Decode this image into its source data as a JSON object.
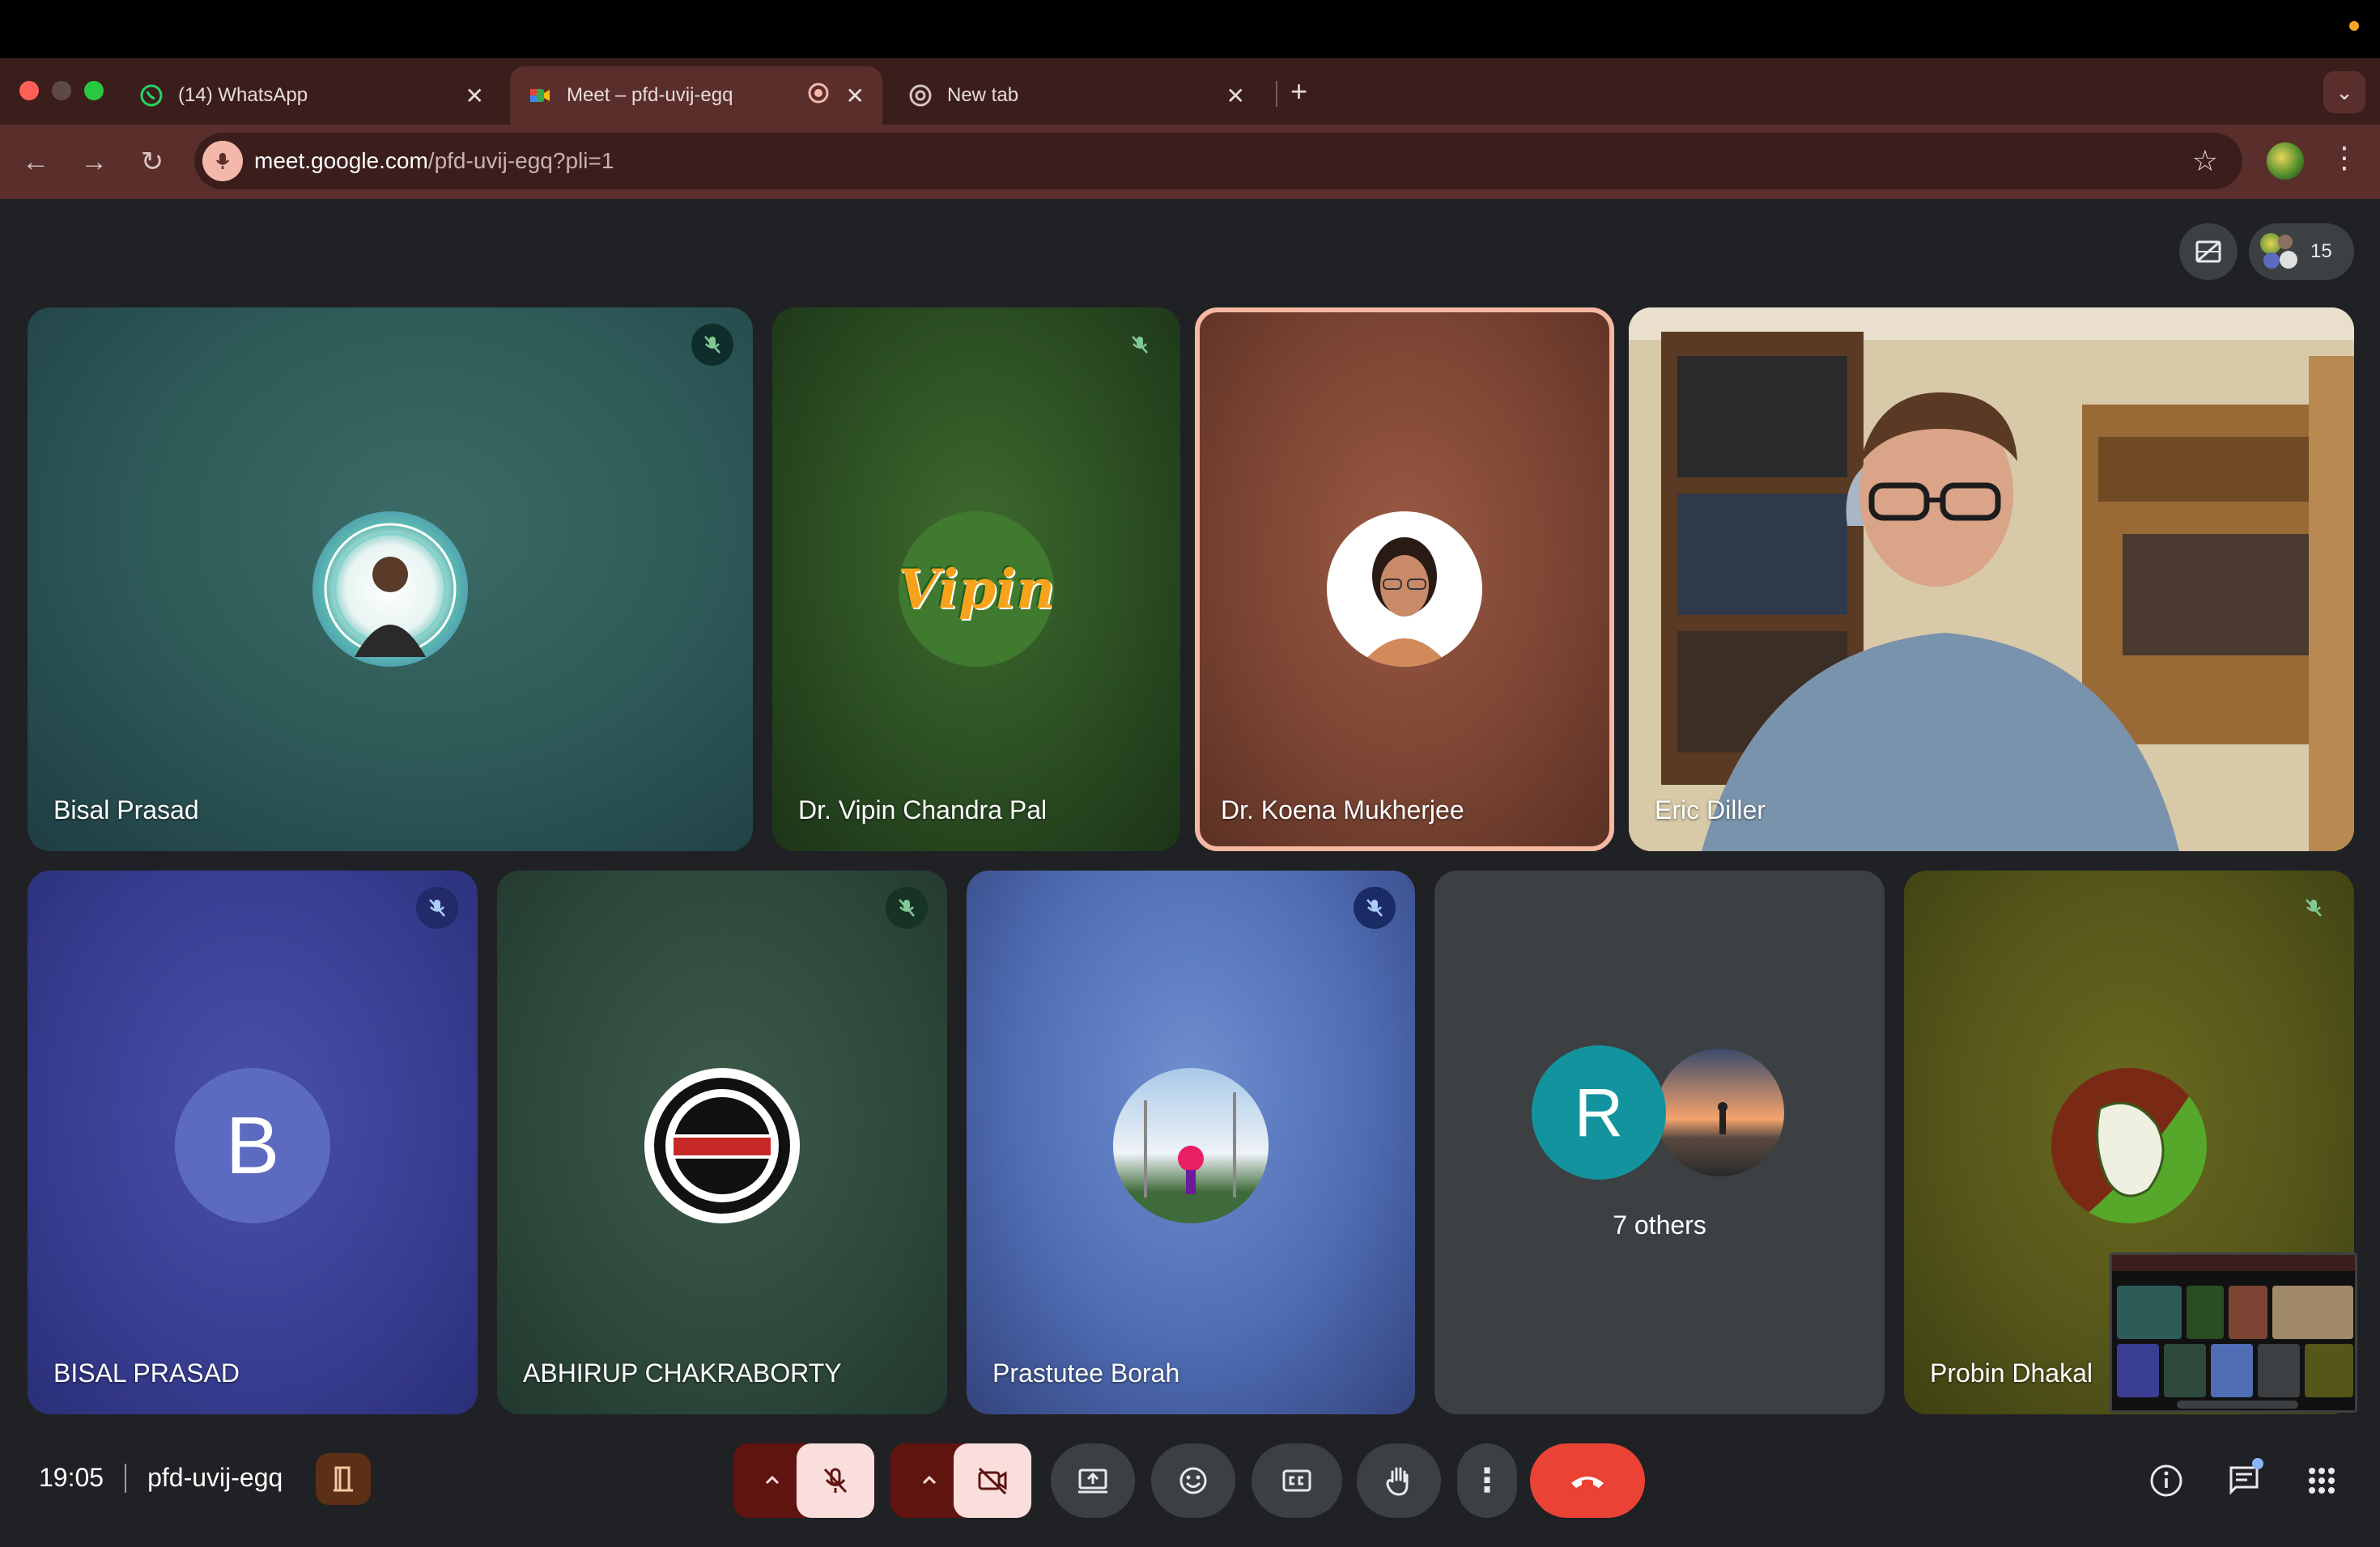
{
  "browser": {
    "tabs": [
      {
        "title": "(14) WhatsApp",
        "icon": "whatsapp-icon"
      },
      {
        "title": "Meet – pfd-uvij-egq",
        "icon": "meet-icon",
        "active": true
      },
      {
        "title": "New tab",
        "icon": "chrome-icon"
      }
    ],
    "url_host": "meet.google.com",
    "url_path": "/pfd-uvij-egq?pli=1"
  },
  "meet": {
    "participant_count": "15",
    "tiles": [
      {
        "name": "Bisal Prasad",
        "muted": true
      },
      {
        "name": "Dr. Vipin Chandra Pal",
        "muted": true,
        "avatar_text": "Vipin"
      },
      {
        "name": "Dr. Koena Mukherjee",
        "speaking": true
      },
      {
        "name": "Eric Diller",
        "video": true
      },
      {
        "name": "BISAL PRASAD",
        "muted": true,
        "avatar_text": "B"
      },
      {
        "name": "ABHIRUP CHAKRABORTY",
        "muted": true
      },
      {
        "name": "Prastutee Borah",
        "muted": true
      },
      {
        "name": "7 others",
        "avatar_text": "R"
      },
      {
        "name": "Probin Dhakal",
        "muted": true
      }
    ],
    "bottom": {
      "time": "19:05",
      "meeting_code": "pfd-uvij-egq"
    }
  },
  "colors": {
    "tabstrip": "#3b1e1c",
    "toolbar": "#5a2f2b",
    "meet_bg": "#202124",
    "leave_red": "#ea4335",
    "speaking_outline": "#f7b8a3"
  }
}
